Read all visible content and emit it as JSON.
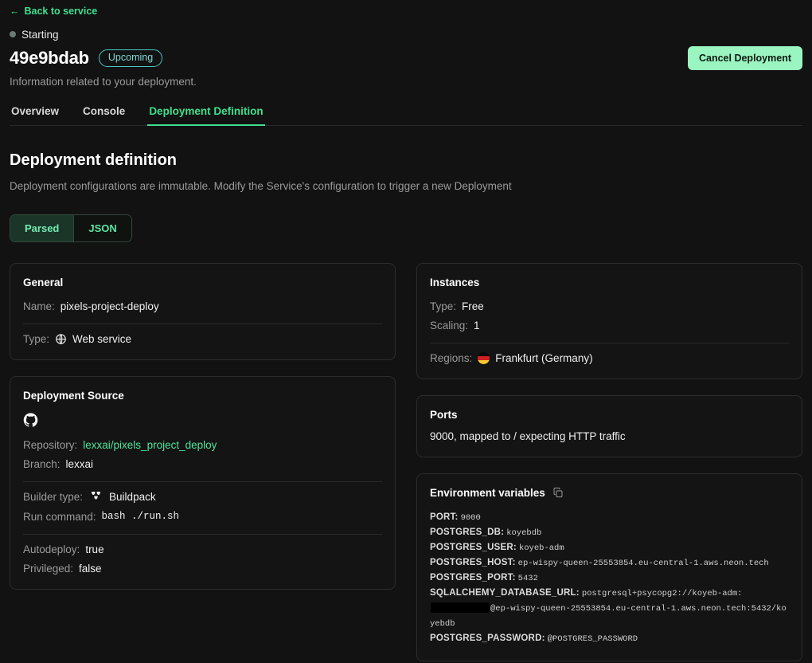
{
  "header": {
    "back_label": "Back to service",
    "back_icon": "arrow-left-icon",
    "status_text": "Starting",
    "status_color": "#6b7a74",
    "deployment_id": "49e9bdab",
    "badge_label": "Upcoming",
    "badge_color": "#7fd8d2",
    "cancel_label": "Cancel Deployment",
    "cancel_color": "#9af5c0",
    "subtitle": "Information related to your deployment."
  },
  "tabs": [
    {
      "label": "Overview",
      "active": false
    },
    {
      "label": "Console",
      "active": false
    },
    {
      "label": "Deployment Definition",
      "active": true
    }
  ],
  "section": {
    "title": "Deployment definition",
    "subtitle": "Deployment configurations are immutable. Modify the Service's configuration to trigger a new Deployment"
  },
  "view_toggle": {
    "options": [
      {
        "label": "Parsed",
        "active": true
      },
      {
        "label": "JSON",
        "active": false
      }
    ],
    "accent": "#5fe3a1"
  },
  "general": {
    "title": "General",
    "name_label": "Name:",
    "name_value": "pixels-project-deploy",
    "type_label": "Type:",
    "type_icon": "globe-icon",
    "type_value": "Web service"
  },
  "deployment_source": {
    "title": "Deployment Source",
    "provider_icon": "github-icon",
    "repository_label": "Repository:",
    "repository_value": "lexxai/pixels_project_deploy",
    "branch_label": "Branch:",
    "branch_value": "lexxai",
    "builder_label": "Builder type:",
    "builder_icon": "buildpack-icon",
    "builder_value": "Buildpack",
    "run_command_label": "Run command:",
    "run_command_value": "bash ./run.sh",
    "autodeploy_label": "Autodeploy:",
    "autodeploy_value": "true",
    "privileged_label": "Privileged:",
    "privileged_value": "false"
  },
  "instances": {
    "title": "Instances",
    "type_label": "Type:",
    "type_value": "Free",
    "scaling_label": "Scaling:",
    "scaling_value": "1",
    "regions_label": "Regions:",
    "regions_flag": "flag-germany-icon",
    "regions_value": "Frankfurt (Germany)"
  },
  "ports": {
    "title": "Ports",
    "value": "9000, mapped to / expecting HTTP traffic"
  },
  "environment_variables": {
    "title": "Environment variables",
    "copy_icon": "copy-icon",
    "items": [
      {
        "key": "PORT:",
        "value": "9000"
      },
      {
        "key": "POSTGRES_DB:",
        "value": "koyebdb"
      },
      {
        "key": "POSTGRES_USER:",
        "value": "koyeb-adm"
      },
      {
        "key": "POSTGRES_HOST:",
        "value": "ep-wispy-queen-25553854.eu-central-1.aws.neon.tech"
      },
      {
        "key": "POSTGRES_PORT:",
        "value": "5432"
      },
      {
        "key": "SQLALCHEMY_DATABASE_URL:",
        "value_before": "postgresql+psycopg2://koyeb-adm:",
        "redacted": true,
        "value_after": "@ep-wispy-queen-25553854.eu-central-1.aws.neon.tech:5432/koyebdb"
      },
      {
        "key": "POSTGRES_PASSWORD:",
        "value": "@POSTGRES_PASSWORD"
      }
    ]
  }
}
